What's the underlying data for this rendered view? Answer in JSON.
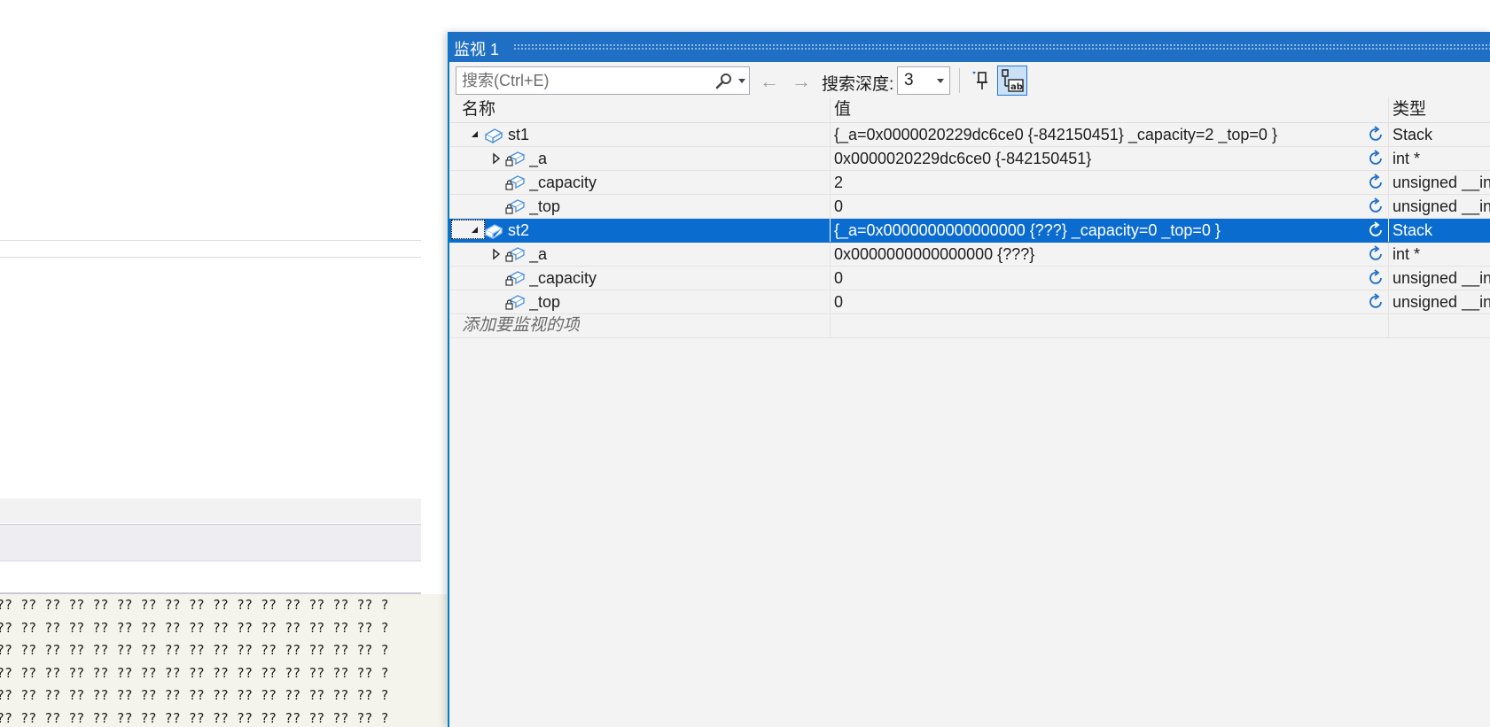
{
  "background": {
    "memory_rows": [
      "?? ?? ?? ?? ?? ?? ?? ?? ?? ?? ?? ?? ?? ?? ?? ?? ?",
      "?? ?? ?? ?? ?? ?? ?? ?? ?? ?? ?? ?? ?? ?? ?? ?? ?",
      "?? ?? ?? ?? ?? ?? ?? ?? ?? ?? ?? ?? ?? ?? ?? ?? ?",
      "?? ?? ?? ?? ?? ?? ?? ?? ?? ?? ?? ?? ?? ?? ?? ?? ?",
      "?? ?? ?? ?? ?? ?? ?? ?? ?? ?? ?? ?? ?? ?? ?? ?? ?",
      "?? ?? ?? ?? ?? ?? ?? ?? ?? ?? ?? ?? ?? ?? ?? ?? ?"
    ]
  },
  "watch": {
    "title": "监视 1",
    "search": {
      "placeholder": "搜索(Ctrl+E)"
    },
    "nav": {
      "back": "←",
      "forward": "→"
    },
    "depth_label": "搜索深度:",
    "depth_value": "3",
    "columns": {
      "name": "名称",
      "value": "值",
      "type": "类型"
    },
    "rows": [
      {
        "name": "st1",
        "value": "{_a=0x0000020229dc6ce0 {-842150451} _capacity=2 _top=0 }",
        "type": "Stack"
      },
      {
        "name": "_a",
        "value": "0x0000020229dc6ce0 {-842150451}",
        "type": "int *"
      },
      {
        "name": "_capacity",
        "value": "2",
        "type": "unsigned __int"
      },
      {
        "name": "_top",
        "value": "0",
        "type": "unsigned __int"
      },
      {
        "name": "st2",
        "value": "{_a=0x0000000000000000 {???} _capacity=0 _top=0 }",
        "type": "Stack"
      },
      {
        "name": "_a",
        "value": "0x0000000000000000 {???}",
        "type": "int *"
      },
      {
        "name": "_capacity",
        "value": "0",
        "type": "unsigned __int"
      },
      {
        "name": "_top",
        "value": "0",
        "type": "unsigned __int"
      }
    ],
    "add_item": "添加要监视的项",
    "accent_color": "#0b6ccf"
  }
}
